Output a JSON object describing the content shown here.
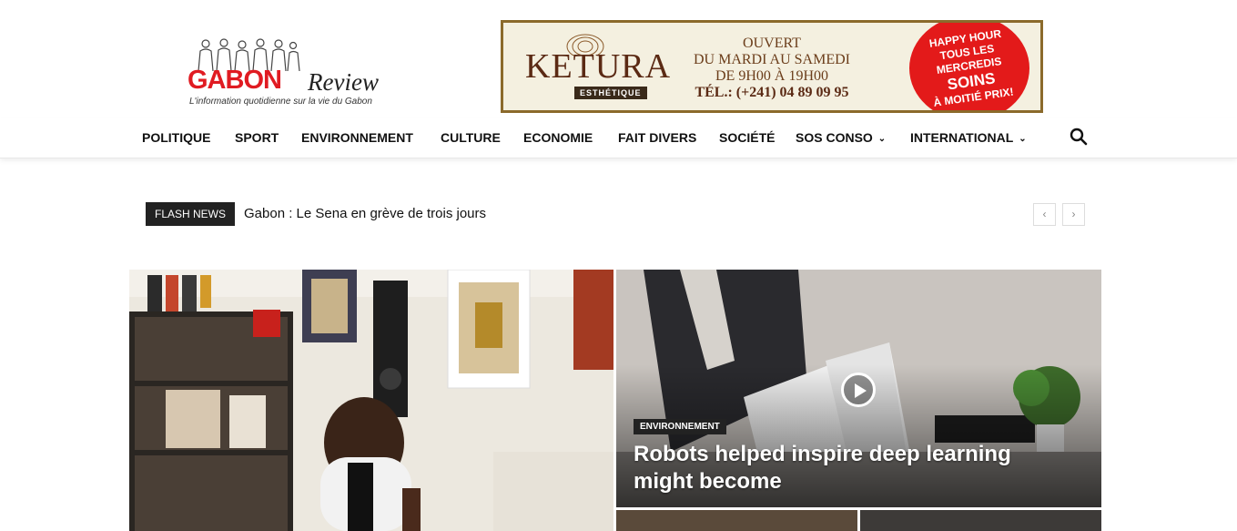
{
  "logo": {
    "brand_main": "GABON",
    "brand_accent": "Review",
    "tagline": "L'information quotidienne sur la vie du Gabon"
  },
  "ad": {
    "brand": "KETURA",
    "brand_sub": "ESTHÉTIQUE",
    "line1": "OUVERT",
    "line2": "DU MARDI AU SAMEDI",
    "line3": "DE 9H00 À 19H00",
    "phone": "TÉL.: (+241) 04 89 09 95",
    "burst1": "HAPPY HOUR",
    "burst2": "TOUS LES MERCREDIS",
    "burst3": "SOINS",
    "burst4": "À MOITIÉ PRIX!"
  },
  "nav": {
    "items": [
      {
        "label": "POLITIQUE"
      },
      {
        "label": "SPORT"
      },
      {
        "label": "ENVIRONNEMENT"
      },
      {
        "label": "CULTURE"
      },
      {
        "label": "ECONOMIE"
      },
      {
        "label": "FAIT DIVERS"
      },
      {
        "label": "SOCIÉTÉ"
      },
      {
        "label": "SOS CONSO"
      },
      {
        "label": "INTERNATIONAL"
      }
    ],
    "search_icon": "search-icon"
  },
  "ticker": {
    "badge": "FLASH NEWS",
    "title": "Gabon : Le Sena en grève de trois jours",
    "prev": "‹",
    "next": "›"
  },
  "featured": {
    "category": "ENVIRONNEMENT",
    "headline": "Robots helped inspire deep learning might become"
  },
  "colors": {
    "brand_red": "#e01b22",
    "dark": "#222222"
  }
}
